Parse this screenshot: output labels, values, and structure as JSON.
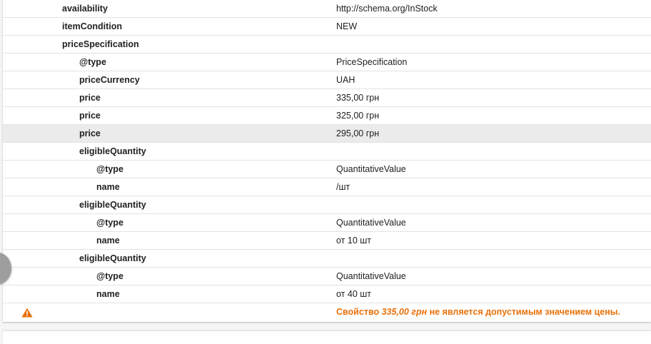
{
  "rows": [
    {
      "key": "availability",
      "value": "http://schema.org/InStock"
    },
    {
      "key": "itemCondition",
      "value": "NEW"
    },
    {
      "key": "priceSpecification",
      "value": ""
    },
    {
      "key": "@type",
      "value": "PriceSpecification"
    },
    {
      "key": "priceCurrency",
      "value": "UAH"
    },
    {
      "key": "price",
      "value": "335,00 грн"
    },
    {
      "key": "price",
      "value": "325,00 грн"
    },
    {
      "key": "price",
      "value": "295,00 грн"
    },
    {
      "key": "eligibleQuantity",
      "value": ""
    },
    {
      "key": "@type",
      "value": "QuantitativeValue"
    },
    {
      "key": "name",
      "value": "/шт"
    },
    {
      "key": "eligibleQuantity",
      "value": ""
    },
    {
      "key": "@type",
      "value": "QuantitativeValue"
    },
    {
      "key": "name",
      "value": "от 10 шт"
    },
    {
      "key": "eligibleQuantity",
      "value": ""
    },
    {
      "key": "@type",
      "value": "QuantitativeValue"
    },
    {
      "key": "name",
      "value": "от 40 шт"
    }
  ],
  "warning": {
    "icon": "warning-icon",
    "color": "#e8710a",
    "prefix": "Свойство ",
    "value": "335,00 грн",
    "suffix": " не является допустимым значением цены."
  },
  "colors": {
    "highlight_row": "#ebebeb",
    "divider": "#e3e3e3",
    "text": "#212121"
  }
}
